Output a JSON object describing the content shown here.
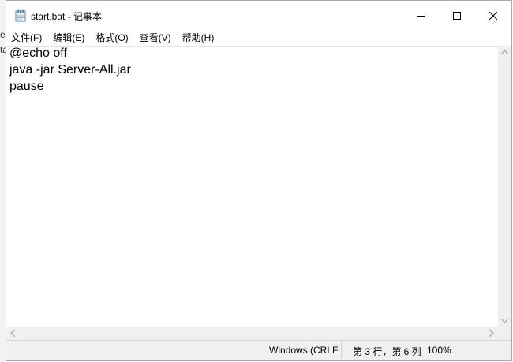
{
  "background_app": {
    "fragments": [
      "e",
      "ta"
    ]
  },
  "window": {
    "title": "start.bat - 记事本",
    "icon": "notepad-icon"
  },
  "controls": {
    "minimize": "minimize-icon",
    "maximize": "maximize-icon",
    "close": "close-icon"
  },
  "menu": {
    "items": [
      "文件(F)",
      "编辑(E)",
      "格式(O)",
      "查看(V)",
      "帮助(H)"
    ]
  },
  "editor": {
    "lines": [
      "@echo off",
      "java -jar Server-All.jar",
      "pause"
    ]
  },
  "statusbar": {
    "line_ending": "Windows (CRLF",
    "position": "第 3 行，第 6 列",
    "zoom": "100%"
  }
}
